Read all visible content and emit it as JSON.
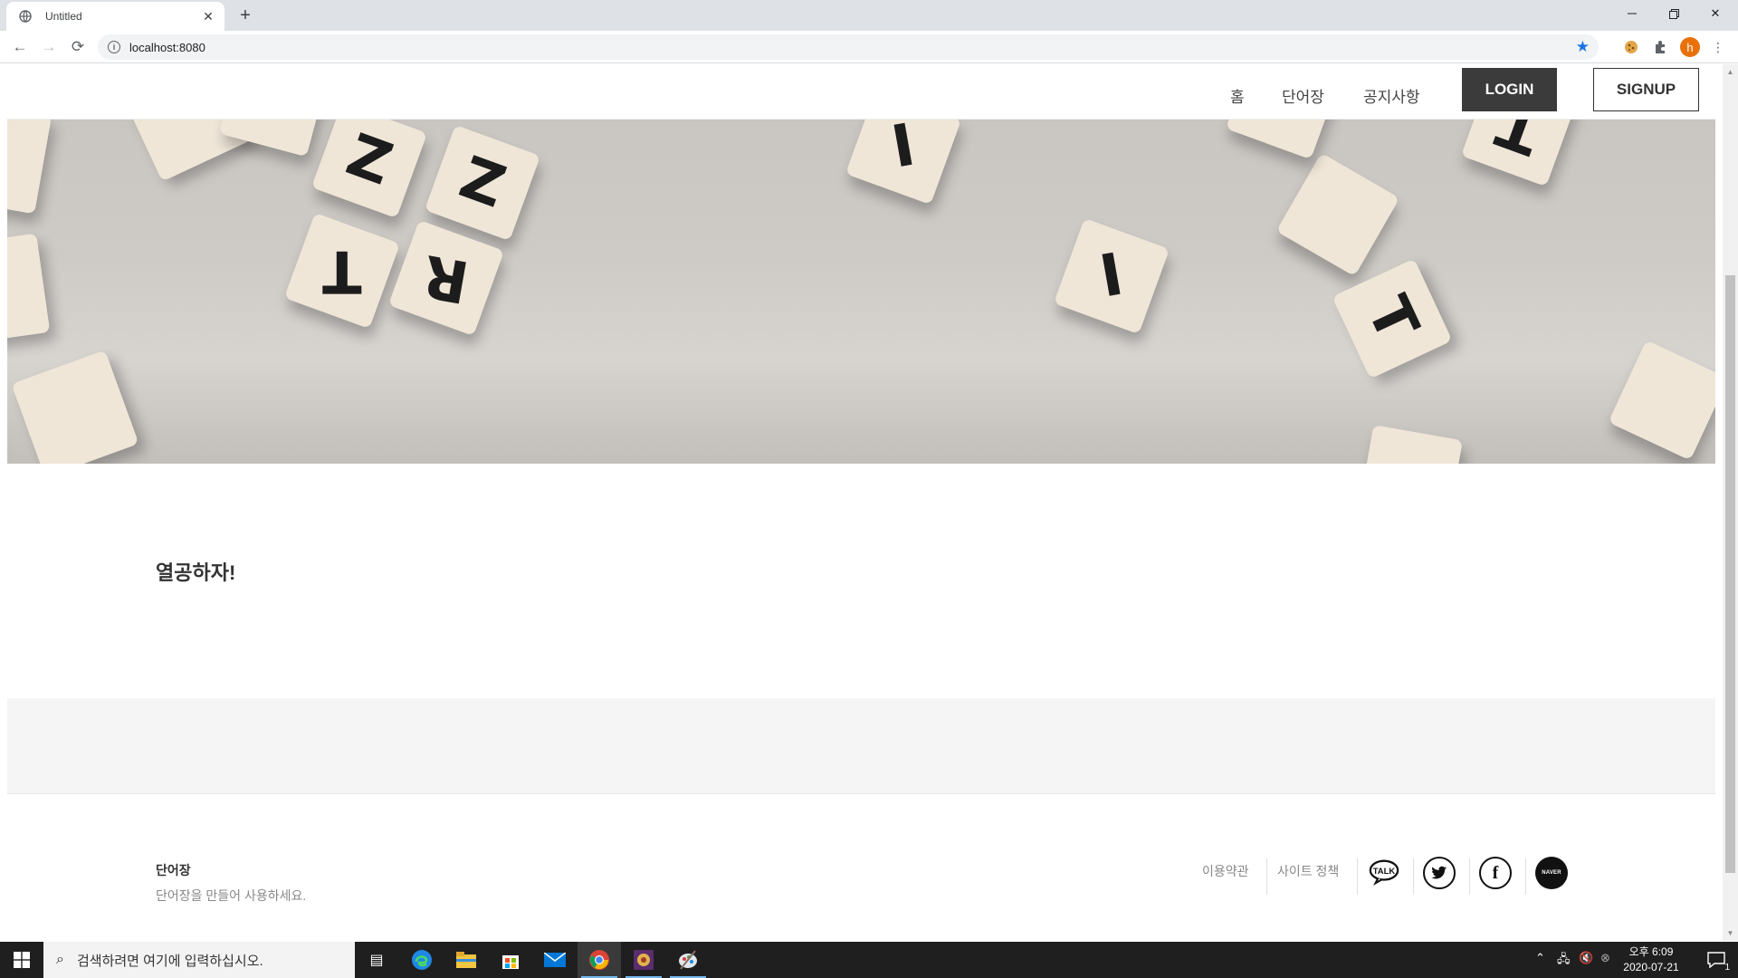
{
  "browser": {
    "tab_title": "Untitled",
    "new_tab_label": "+",
    "url": "localhost:8080",
    "profile_initial": "h"
  },
  "site": {
    "nav": {
      "home": "홈",
      "wordbook": "단어장",
      "notice": "공지사항",
      "login": "LOGIN",
      "signup": "SIGNUP"
    },
    "hero_tiles": [
      "Z",
      "Z",
      "T",
      "R",
      "I",
      "I",
      "T",
      "T"
    ],
    "content_title": "열공하자!",
    "footer": {
      "title": "단어장",
      "description": "단어장을 만들어 사용하세요.",
      "links": [
        "이용약관",
        "사이트 정책"
      ],
      "social": [
        "TALK",
        "twitter-icon",
        "facebook-icon",
        "NAVER"
      ]
    }
  },
  "taskbar": {
    "search_placeholder": "검색하려면 여기에 입력하십시오.",
    "clock_time": "오후 6:09",
    "clock_date": "2020-07-21",
    "notification_count": "1"
  },
  "colors": {
    "login_bg": "#3b3b3b",
    "chrome_tabbar": "#dee1e6",
    "taskbar": "#1f1f1f",
    "star": "#1a73e8",
    "profile": "#e8710a"
  }
}
